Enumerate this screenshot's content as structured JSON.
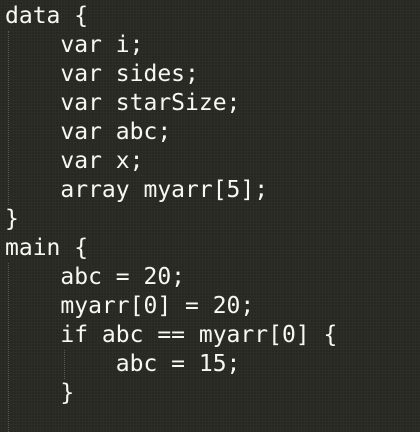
{
  "editor": {
    "lines": [
      "data {",
      "    var i;",
      "    var sides;",
      "    var starSize;",
      "    var abc;",
      "    var x;",
      "    array myarr[5];",
      "}",
      "main {",
      "    abc = 20;",
      "    myarr[0] = 20;",
      "    if abc == myarr[0] {",
      "        abc = 15;",
      "    }"
    ],
    "background": "#272822",
    "foreground": "#f8f8f2"
  }
}
